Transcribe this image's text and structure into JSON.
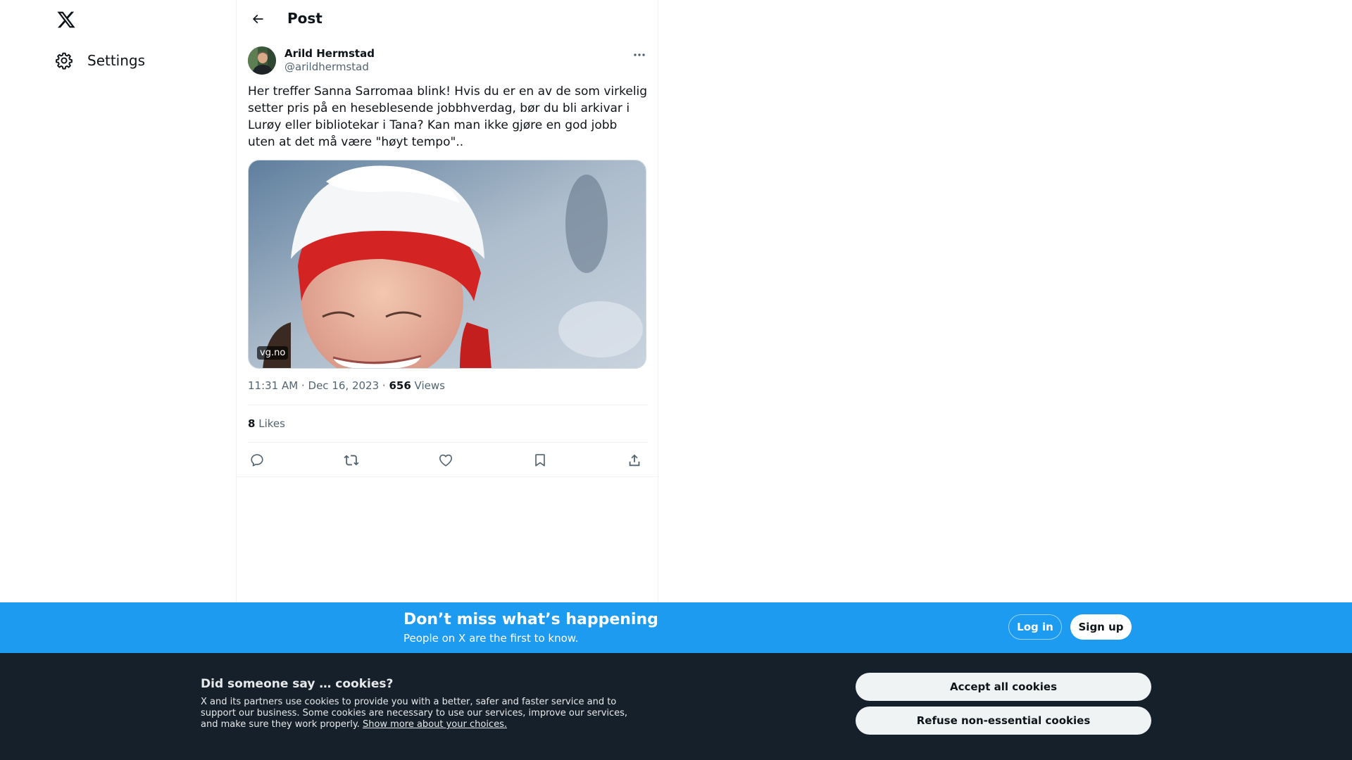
{
  "nav": {
    "logo_icon": "x-logo-icon",
    "settings_label": "Settings",
    "settings_icon": "gear-icon"
  },
  "header": {
    "title": "Post",
    "back_icon": "arrow-left-icon"
  },
  "post": {
    "author_name": "Arild Hermstad",
    "author_handle": "@arildhermstad",
    "text": "Her treffer Sanna Sarromaa blink! Hvis du er en av de som virkelig setter pris på en heseblesende jobbhverdag, bør du bli arkivar i Lurøy eller bibliotekar i Tana? Kan man ikke gjøre en god jobb uten at det må være \"høyt tempo\"..",
    "media_source": "vg.no",
    "time": "11:31 AM",
    "date": "Dec 16, 2023",
    "views_count": "656",
    "views_label": "Views",
    "likes_count": "8",
    "likes_label": "Likes",
    "actions": [
      "reply-icon",
      "repost-icon",
      "like-icon",
      "bookmark-icon",
      "share-icon"
    ]
  },
  "signup_bar": {
    "title": "Don’t miss what’s happening",
    "subtitle": "People on X are the first to know.",
    "login_label": "Log in",
    "signup_label": "Sign up"
  },
  "cookies": {
    "title": "Did someone say … cookies?",
    "text": "X and its partners use cookies to provide you with a better, safer and faster service and to support our business. Some cookies are necessary to use our services, improve our services, and make sure they work properly.",
    "link_label": "Show more about your choices.",
    "accept_label": "Accept all cookies",
    "refuse_label": "Refuse non-essential cookies"
  },
  "colors": {
    "brand_blue": "#1d9bf0",
    "cookie_bg": "#15202b",
    "text_primary": "#0f1419",
    "text_secondary": "#536471"
  }
}
